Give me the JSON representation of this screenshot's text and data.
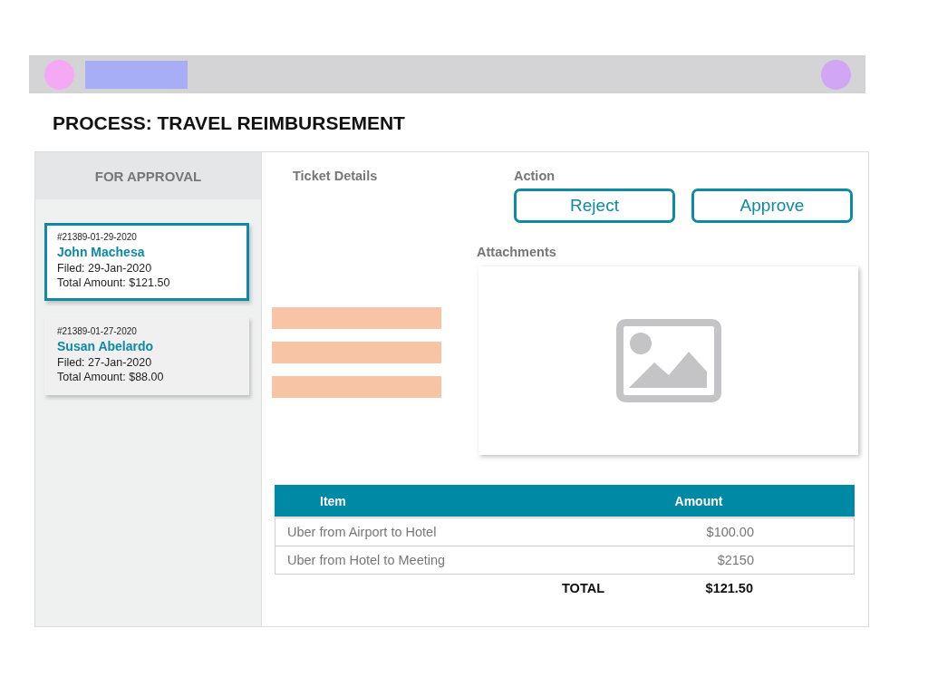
{
  "page_title": "PROCESS: TRAVEL REIMBURSEMENT",
  "sidebar": {
    "heading": "FOR APPROVAL",
    "tickets": [
      {
        "number": "#21389-01-29-2020",
        "name": "John Machesa",
        "filed": "Filed: 29-Jan-2020",
        "total": "Total Amount: $121.50",
        "selected": true
      },
      {
        "number": "#21389-01-27-2020",
        "name": "Susan Abelardo",
        "filed": "Filed: 27-Jan-2020",
        "total": "Total Amount: $88.00",
        "selected": false
      }
    ]
  },
  "ticket_details": {
    "heading": "Ticket Details"
  },
  "action": {
    "heading": "Action",
    "buttons": [
      "Reject",
      "Approve"
    ]
  },
  "attachments": {
    "heading": "Attachments"
  },
  "table": {
    "columns": [
      "Item",
      "Amount"
    ],
    "rows": [
      {
        "item": "Uber from Airport to Hotel",
        "amount": "$100.00"
      },
      {
        "item": "Uber from Hotel to Meeting",
        "amount": "$2150"
      }
    ],
    "total_label": "TOTAL",
    "total_value": "$121.50"
  }
}
